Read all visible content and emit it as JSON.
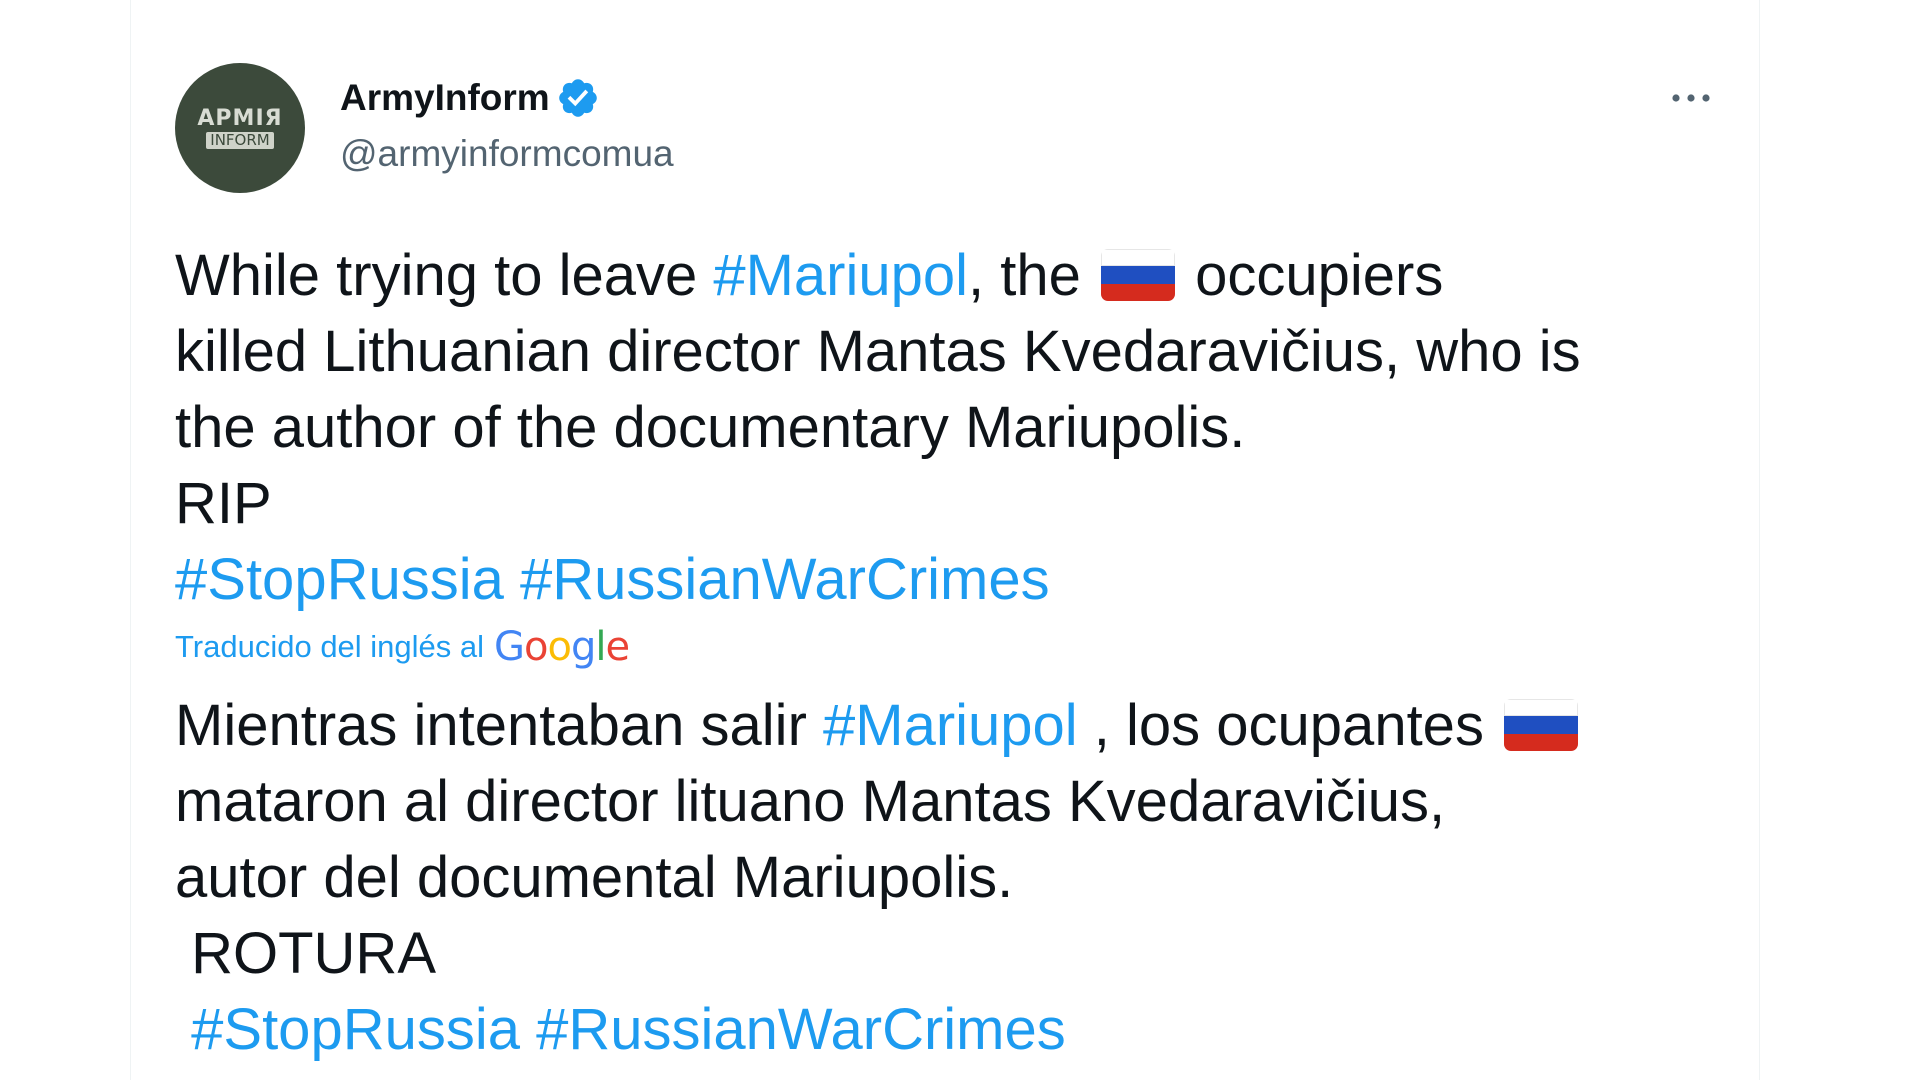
{
  "author": {
    "display_name": "ArmyInform",
    "handle": "@armyinformcomua",
    "avatar_text_top": "АРМІЯ",
    "avatar_text_bottom": "INFORM",
    "verified": true
  },
  "tweet": {
    "line1_a": "While trying to leave ",
    "line1_tag": "#Mariupol",
    "line1_b": ", the ",
    "line1_c": " occupiers",
    "line2": "killed Lithuanian director Mantas Kvedaravičius, who is",
    "line3": "the author of the documentary Mariupolis.",
    "line4": "RIP",
    "tag_stoprussia": "#StopRussia",
    "tag_warcrimes": "#RussianWarCrimes"
  },
  "translation": {
    "label": "Traducido del inglés al",
    "google": [
      "G",
      "o",
      "o",
      "g",
      "l",
      "e"
    ],
    "line1_a": "Mientras intentaban salir ",
    "line1_tag": "#Mariupol",
    "line1_b": " , los ocupantes ",
    "line2": "mataron al director lituano Mantas Kvedaravičius,",
    "line3": "autor del documental Mariupolis.",
    "line4": " ROTURA",
    "tag_stoprussia": "#StopRussia",
    "tag_warcrimes": "#RussianWarCrimes"
  },
  "icons": {
    "verified": "verified-badge-icon",
    "more": "more-horizontal-icon",
    "flag": "russia-flag-icon"
  },
  "colors": {
    "link": "#1d9bf0",
    "text": "#0f1419",
    "muted": "#536471",
    "google_blue": "#4285F4",
    "google_red": "#EA4335",
    "google_yellow": "#FBBC05",
    "google_green": "#34A853",
    "flag_white": "#ffffff",
    "flag_blue": "#1f4fc1",
    "flag_red": "#d52b1e"
  }
}
